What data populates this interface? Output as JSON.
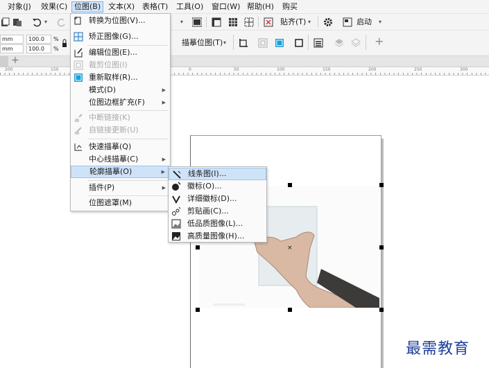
{
  "menubar": {
    "items": [
      "对象(J)",
      "效果(C)",
      "位图(B)",
      "文本(X)",
      "表格(T)",
      "工具(O)",
      "窗口(W)",
      "帮助(H)",
      "购买"
    ]
  },
  "toolbar": {
    "snap_label": "贴齐(T)",
    "launch_label": "启动"
  },
  "propbar": {
    "unit1": "mm",
    "unit2": "mm",
    "w_pct": "100.0",
    "h_pct": "100.0",
    "pct": "%",
    "trace_label": "描摹位图(T)"
  },
  "ruler": {
    "ticks": [
      "200",
      "150",
      "0",
      "50",
      "100",
      "150",
      "200",
      "250",
      "300"
    ]
  },
  "bitmap_menu": {
    "items": [
      {
        "label": "转换为位图(V)...",
        "disabled": false,
        "submenu": false
      },
      {
        "label": "矫正图像(G)...",
        "disabled": false,
        "submenu": false
      },
      {
        "label": "编辑位图(E)...",
        "disabled": false,
        "submenu": false
      },
      {
        "label": "裁剪位图(I)",
        "disabled": true,
        "submenu": false
      },
      {
        "label": "重新取样(R)...",
        "disabled": false,
        "submenu": false
      },
      {
        "label": "模式(D)",
        "disabled": false,
        "submenu": true
      },
      {
        "label": "位图边框扩充(F)",
        "disabled": false,
        "submenu": true
      },
      {
        "label": "中断链接(K)",
        "disabled": true,
        "submenu": false
      },
      {
        "label": "自链接更新(U)",
        "disabled": true,
        "submenu": false
      },
      {
        "label": "快速描摹(Q)",
        "disabled": false,
        "submenu": false
      },
      {
        "label": "中心线描摹(C)",
        "disabled": false,
        "submenu": true
      },
      {
        "label": "轮廓描摹(O)",
        "disabled": false,
        "submenu": true
      },
      {
        "label": "插件(P)",
        "disabled": false,
        "submenu": true
      },
      {
        "label": "位图遮罩(M)",
        "disabled": false,
        "submenu": false
      }
    ]
  },
  "outline_trace_submenu": {
    "items": [
      "线条图(I)...",
      "徽标(O)...",
      "详细徽标(D)...",
      "剪贴画(C)...",
      "低品质图像(L)...",
      "高质量图像(H)..."
    ]
  },
  "watermark": "最需教育"
}
